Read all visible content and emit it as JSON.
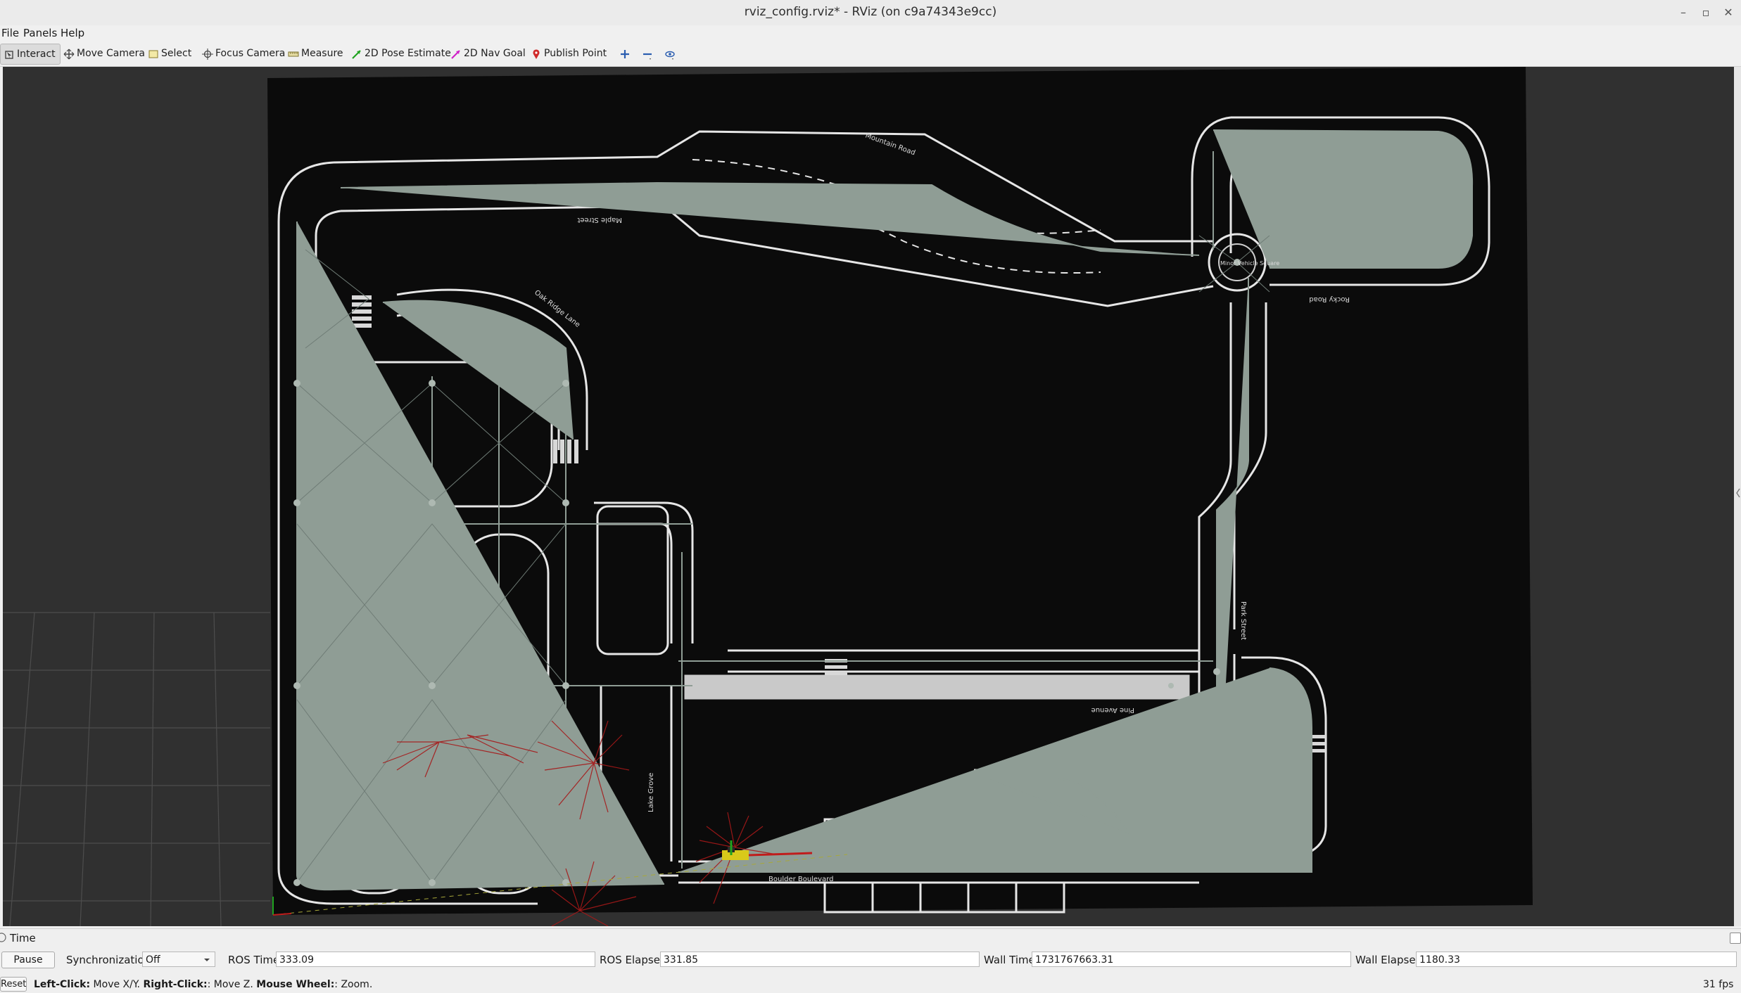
{
  "window": {
    "title": "rviz_config.rviz* - RViz (on c9a74343e9cc)",
    "controls": {
      "minimize": "–",
      "maximize": "▫",
      "close": "✕"
    }
  },
  "menu": {
    "file": "File",
    "panels": "Panels",
    "help": "Help"
  },
  "toolbar": {
    "interact": "Interact",
    "move_camera": "Move Camera",
    "select": "Select",
    "focus_camera": "Focus Camera",
    "measure": "Measure",
    "pose_estimate": "2D Pose Estimate",
    "nav_goal": "2D Nav Goal",
    "publish_point": "Publish Point"
  },
  "map": {
    "labels": [
      "Boulder Boulevard",
      "Lake Grove",
      "Minor Vehicle Square",
      "Mountain Road",
      "Rocky Road",
      "Oak Ridge Lane",
      "Park Street",
      "Pine Avenue",
      "Maple Street"
    ],
    "colors": {
      "background": "#0b0b0b",
      "road": "#e6e6e6",
      "arrows": "#9aa8a0",
      "laser": "#b21a1a",
      "grid": "#4a4a4a"
    }
  },
  "time_panel": {
    "header": "Time",
    "pause_label": "Pause",
    "sync_label": "Synchronization:",
    "sync_value": "Off",
    "ros_time_label": "ROS Time:",
    "ros_time": "333.09",
    "ros_elapsed_label": "ROS Elapsed:",
    "ros_elapsed": "331.85",
    "wall_time_label": "Wall Time:",
    "wall_time": "1731767663.31",
    "wall_elapsed_label": "Wall Elapsed:",
    "wall_elapsed": "1180.33"
  },
  "status": {
    "reset_label": "Reset",
    "left_click": "Left-Click:",
    "left_click_desc": " Move X/Y. ",
    "right_click": "Right-Click:",
    "right_click_desc": ": Move Z. ",
    "mouse_wheel": "Mouse Wheel:",
    "mouse_wheel_desc": ": Zoom.",
    "fps": "31 fps"
  }
}
